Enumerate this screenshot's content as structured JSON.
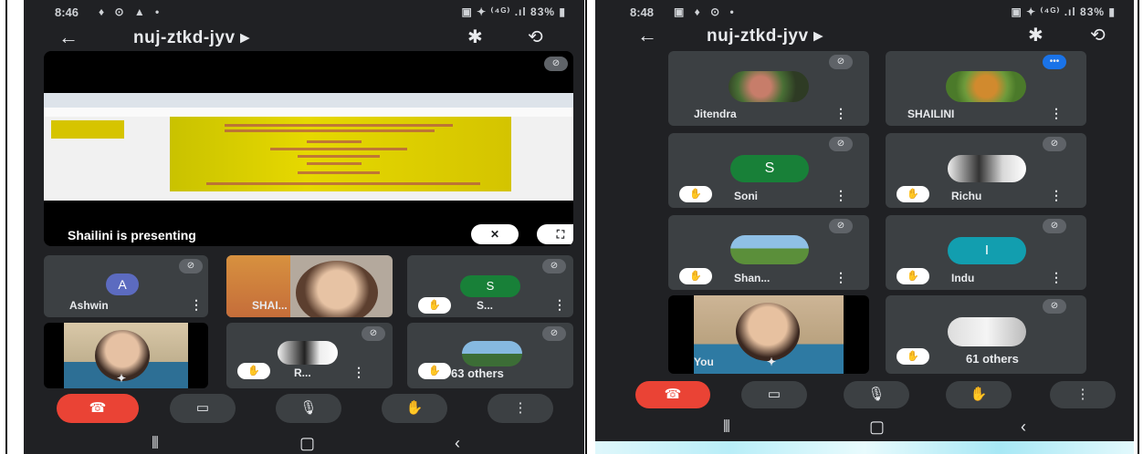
{
  "left": {
    "status": {
      "time": "8:46",
      "icons": "♦ ⊙ ▲ •",
      "right": "▣ ✦ ⁽⁴ᴳ⁾ .ıl 83% ▮"
    },
    "meeting_code": "nuj-ztkd-jyv",
    "presentation_caption": "Shailini is presenting",
    "tiles": {
      "ashwin": {
        "initial": "A",
        "name": "Ashwin"
      },
      "shai": {
        "name": "SHAI..."
      },
      "s": {
        "initial": "S",
        "name": "S..."
      },
      "r": {
        "name": "R..."
      },
      "others": {
        "label": "63 others"
      }
    }
  },
  "right": {
    "status": {
      "time": "8:48",
      "icons": "▣ ♦ ⊙ •",
      "right": "▣ ✦ ⁽⁴ᴳ⁾ .ıl 83% ▮"
    },
    "meeting_code": "nuj-ztkd-jyv",
    "tiles": {
      "jitendra": {
        "name": "Jitendra"
      },
      "shailini": {
        "name": "SHAILINI"
      },
      "soni": {
        "initial": "S",
        "name": "Soni"
      },
      "richu": {
        "name": "Richu"
      },
      "shan": {
        "name": "Shan..."
      },
      "indu": {
        "initial": "I",
        "name": "Indu"
      },
      "you": {
        "name": "You"
      },
      "others": {
        "label": "61 others"
      }
    }
  },
  "colors": {
    "bg": "#202124",
    "tile": "#3c4043",
    "end_call": "#ea4335",
    "avatar_blue": "#5c6bc0",
    "avatar_green": "#188038",
    "avatar_teal": "#129eaf"
  },
  "icons": [
    "back-arrow-icon",
    "bluetooth-icon",
    "switch-camera-icon",
    "mic-off-icon",
    "hand-raise-icon",
    "more-vert-icon",
    "end-call-icon",
    "camera-icon",
    "mic-icon",
    "expand-icon",
    "pin-off-icon"
  ]
}
